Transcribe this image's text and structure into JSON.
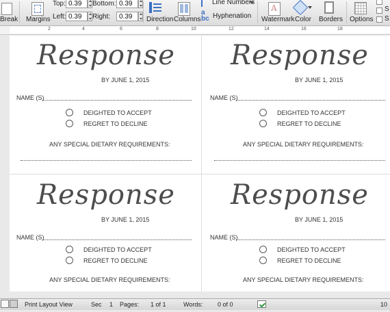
{
  "ribbon": {
    "break_label": "Break",
    "margins_label": "Margins",
    "top_label": "Top:",
    "top_value": "0.39",
    "left_label": "Left:",
    "left_value": "0.39",
    "bottom_label": "Bottom:",
    "bottom_value": "0.39",
    "right_label": "Right:",
    "right_value": "0.39",
    "direction_label": "Direction",
    "columns_label": "Columns",
    "line_numbers_label": "Line Numbers",
    "hyphenation_label": "Hyphenation",
    "watermark_label": "Watermark",
    "color_label": "Color",
    "borders_label": "Borders",
    "options_label": "Options",
    "s1_label": "S",
    "s2_label": "S"
  },
  "ruler": {
    "marks": [
      "2",
      "4",
      "6",
      "8",
      "10",
      "12",
      "14",
      "16",
      "18"
    ]
  },
  "cards": [
    {
      "title": "Response",
      "date": "BY JUNE 1, 2015",
      "name_label": "NAME (S)",
      "option_accept": "DEIGHTED TO ACCEPT",
      "option_decline": "REGRET TO DECLINE",
      "dietary": "ANY SPECIAL DIETARY REQUIREMENTS:"
    },
    {
      "title": "Response",
      "date": "BY JUNE 1, 2015",
      "name_label": "NAME (S)",
      "option_accept": "DEIGHTED TO ACCEPT",
      "option_decline": "REGRET TO DECLINE",
      "dietary": "ANY SPECIAL DIETARY REQUIREMENTS:"
    },
    {
      "title": "Response",
      "date": "BY JUNE 1, 2015",
      "name_label": "NAME (S)",
      "option_accept": "DEIGHTED TO ACCEPT",
      "option_decline": "REGRET TO DECLINE",
      "dietary": "ANY SPECIAL DIETARY REQUIREMENTS:"
    },
    {
      "title": "Response",
      "date": "BY JUNE 1, 2015",
      "name_label": "NAME (S)",
      "option_accept": "DEIGHTED TO ACCEPT",
      "option_decline": "REGRET TO DECLINE",
      "dietary": "ANY SPECIAL DIETARY REQUIREMENTS:"
    }
  ],
  "status_bar": {
    "view": "Print Layout View",
    "sec_label": "Sec",
    "sec_value": "1",
    "pages_label": "Pages:",
    "pages_value": "1 of 1",
    "words_label": "Words:",
    "words_value": "0 of 0",
    "zoom": "10"
  }
}
